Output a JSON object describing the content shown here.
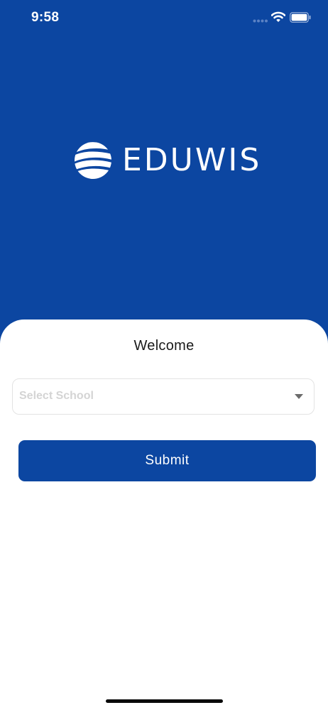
{
  "status_bar": {
    "time": "9:58"
  },
  "brand": {
    "name": "EDUWIS",
    "logo_icon": "wave-globe-icon"
  },
  "login": {
    "welcome": "Welcome",
    "school_select": {
      "placeholder": "Select School",
      "icon": "triangle-down-icon"
    },
    "submit_label": "Submit"
  },
  "colors": {
    "brand_blue": "#0c46a1",
    "background": "#ffffff",
    "placeholder_gray": "#d4d4d4"
  }
}
